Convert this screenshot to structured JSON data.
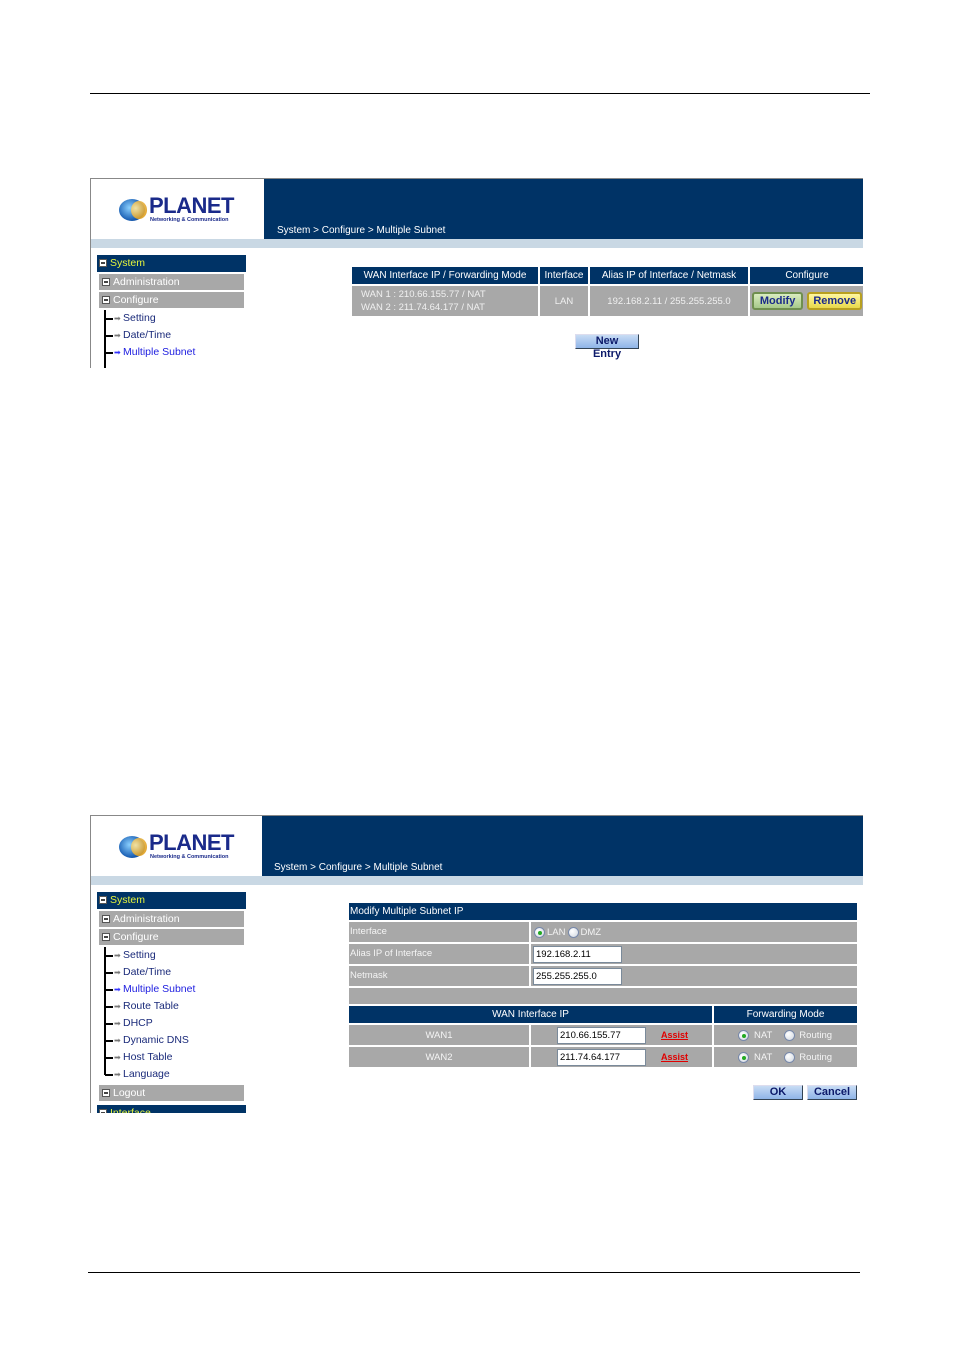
{
  "brand": {
    "name": "PLANET",
    "tagline": "Networking & Communication"
  },
  "breadcrumb": "System > Configure > Multiple Subnet",
  "screen1": {
    "nav": {
      "head": "System",
      "sections": [
        {
          "label": "Administration",
          "icon": "plus-box-icon"
        },
        {
          "label": "Configure",
          "icon": "minus-box-icon"
        }
      ],
      "items": [
        {
          "label": "Setting"
        },
        {
          "label": "Date/Time"
        },
        {
          "label": "Multiple Subnet",
          "active": true
        }
      ]
    },
    "table": {
      "headers": [
        "WAN Interface IP / Forwarding Mode",
        "Interface",
        "Alias IP of Interface / Netmask",
        "Configure"
      ],
      "rows": [
        {
          "wan_lines": [
            "WAN 1 : 210.66.155.77 / NAT",
            "WAN 2 : 211.74.64.177 / NAT"
          ],
          "interface": "LAN",
          "alias": "192.168.2.11 / 255.255.255.0",
          "modify": "Modify",
          "remove": "Remove"
        }
      ]
    },
    "new_entry": "New Entry"
  },
  "screen2": {
    "nav": {
      "head": "System",
      "sections": [
        {
          "label": "Administration"
        },
        {
          "label": "Configure"
        }
      ],
      "items": [
        {
          "label": "Setting"
        },
        {
          "label": "Date/Time"
        },
        {
          "label": "Multiple Subnet",
          "active": true
        },
        {
          "label": "Route Table"
        },
        {
          "label": "DHCP"
        },
        {
          "label": "Dynamic DNS"
        },
        {
          "label": "Host Table"
        },
        {
          "label": "Language"
        }
      ],
      "logout": "Logout",
      "next_head": "Interface"
    },
    "form": {
      "title": "Modify Multiple Subnet IP",
      "interface_label": "Interface",
      "interface_options": [
        "LAN",
        "DMZ"
      ],
      "interface_selected": "LAN",
      "alias_label": "Alias IP of Interface",
      "alias_value": "192.168.2.11",
      "netmask_label": "Netmask",
      "netmask_value": "255.255.255.0",
      "wan_header": "WAN Interface IP",
      "mode_header": "Forwarding Mode",
      "wan_rows": [
        {
          "name": "WAN1",
          "ip": "210.66.155.77",
          "assist": "Assist",
          "mode": "NAT"
        },
        {
          "name": "WAN2",
          "ip": "211.74.64.177",
          "assist": "Assist",
          "mode": "NAT"
        }
      ],
      "mode_options": [
        "NAT",
        "Routing"
      ],
      "ok": "OK",
      "cancel": "Cancel"
    }
  }
}
